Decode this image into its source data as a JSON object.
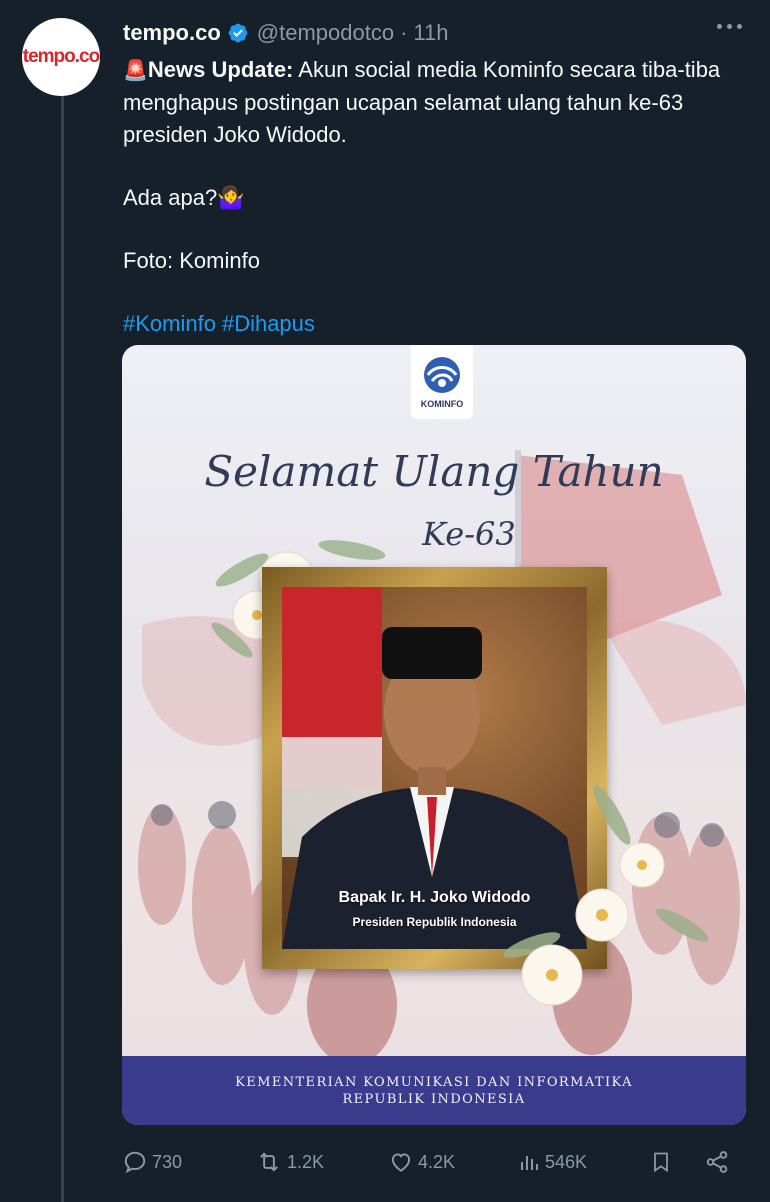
{
  "tweet": {
    "avatar_text": "tempo.co",
    "display_name": "tempo.co",
    "handle": "@tempodotco",
    "separator": "·",
    "time": "11h",
    "siren": "🚨",
    "lead_bold": "News Update:",
    "lead_text": " Akun social media Kominfo secara tiba-tiba menghapus postingan ucapan selamat ulang tahun ke-63 presiden Joko Widodo.",
    "line2": "Ada apa?🤷‍♀️",
    "line3": "Foto: Kominfo",
    "hashtags": [
      "#Kominfo",
      "#Dihapus"
    ]
  },
  "media": {
    "kominfo_label": "KOMINFO",
    "greeting_line1": "Selamat Ulang Tahun",
    "greeting_line2": "Ke-63",
    "person_name": "Bapak Ir. H. Joko Widodo",
    "person_title": "Presiden Republik Indonesia",
    "footer_line1": "KEMENTERIAN KOMUNIKASI DAN INFORMATIKA",
    "footer_line2": "REPUBLIK INDONESIA"
  },
  "actions": {
    "replies": "730",
    "reposts": "1.2K",
    "likes": "4.2K",
    "views": "546K"
  },
  "colors": {
    "background": "#15202b",
    "text_primary": "#f7f9f9",
    "text_secondary": "#8b98a5",
    "link": "#1d9bf0",
    "verified": "#1d9bf0",
    "brand_red": "#d7262e",
    "footer_band": "#3a3b8c"
  },
  "icons": [
    "more-icon",
    "verified-badge-icon",
    "reply-icon",
    "repost-icon",
    "like-icon",
    "views-icon",
    "bookmark-icon",
    "share-icon"
  ]
}
